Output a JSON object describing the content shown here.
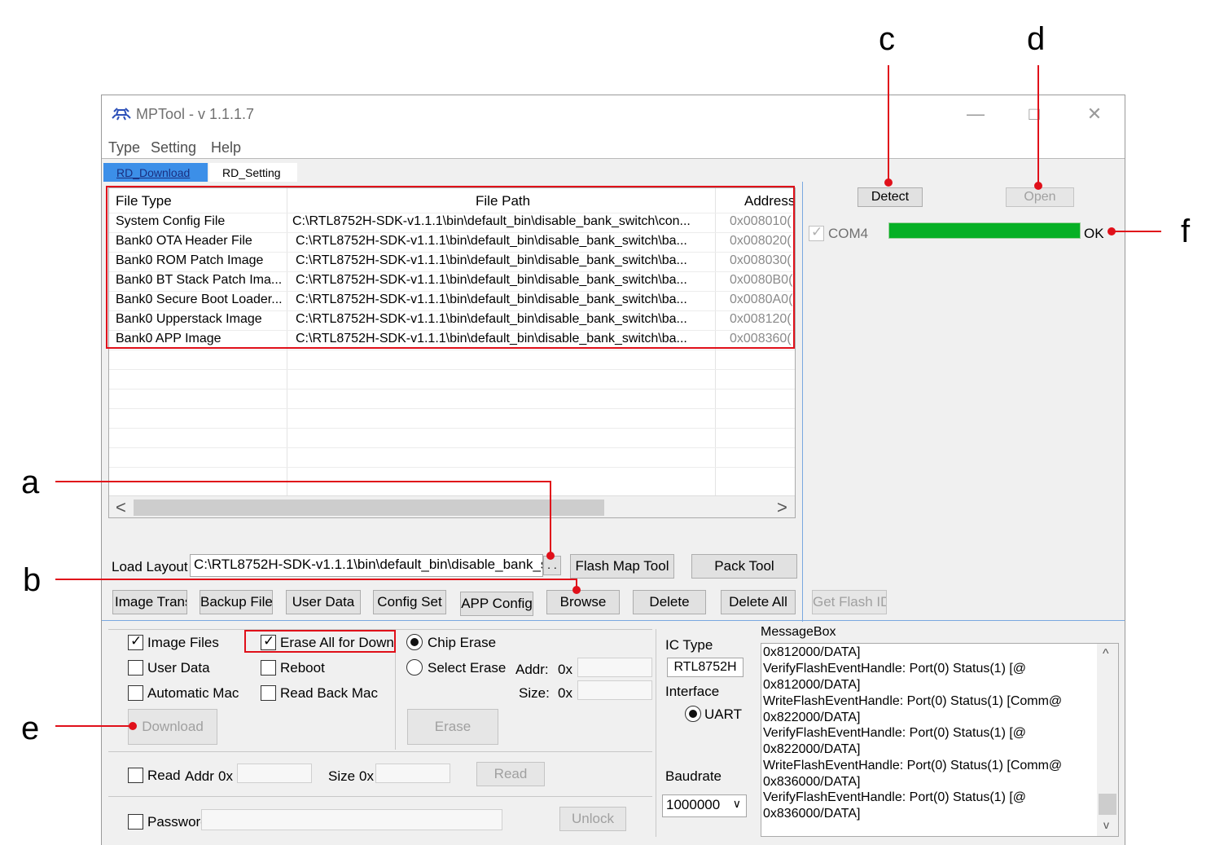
{
  "window": {
    "title": "MPTool - v 1.1.1.7",
    "controls": {
      "minimize": "—",
      "maximize": "□",
      "close": "✕"
    }
  },
  "menu": [
    "Type",
    "Setting",
    "Help"
  ],
  "tabs": [
    {
      "label": "RD_Download",
      "active": true
    },
    {
      "label": "RD_Setting",
      "active": false
    }
  ],
  "file_table": {
    "columns": [
      "File Type",
      "File Path",
      "Address"
    ],
    "rows": [
      {
        "type": "System Config File",
        "path": "C:\\RTL8752H-SDK-v1.1.1\\bin\\default_bin\\disable_bank_switch\\con...",
        "address": "0x008010("
      },
      {
        "type": "Bank0 OTA Header File",
        "path": "C:\\RTL8752H-SDK-v1.1.1\\bin\\default_bin\\disable_bank_switch\\ba...",
        "address": "0x008020("
      },
      {
        "type": "Bank0 ROM Patch Image",
        "path": "C:\\RTL8752H-SDK-v1.1.1\\bin\\default_bin\\disable_bank_switch\\ba...",
        "address": "0x008030("
      },
      {
        "type": "Bank0 BT Stack Patch Ima...",
        "path": "C:\\RTL8752H-SDK-v1.1.1\\bin\\default_bin\\disable_bank_switch\\ba...",
        "address": "0x0080B0("
      },
      {
        "type": "Bank0 Secure Boot Loader...",
        "path": "C:\\RTL8752H-SDK-v1.1.1\\bin\\default_bin\\disable_bank_switch\\ba...",
        "address": "0x0080A0("
      },
      {
        "type": "Bank0 Upperstack Image",
        "path": "C:\\RTL8752H-SDK-v1.1.1\\bin\\default_bin\\disable_bank_switch\\ba...",
        "address": "0x008120("
      },
      {
        "type": "Bank0 APP Image",
        "path": "C:\\RTL8752H-SDK-v1.1.1\\bin\\default_bin\\disable_bank_switch\\ba...",
        "address": "0x008360("
      }
    ],
    "scroll_left": "<",
    "scroll_right": ">"
  },
  "load_layout": {
    "label": "Load Layout",
    "value": "C:\\RTL8752H-SDK-v1.1.1\\bin\\default_bin\\disable_bank_s",
    "browse_dots": ". ."
  },
  "buttons": {
    "flash_map_tool": "Flash Map Tool",
    "pack_tool": "Pack Tool",
    "image_trans": "Image Trans",
    "backup_files": "Backup Files",
    "user_data": "User Data",
    "config_set": "Config Set",
    "app_config": "APP Config",
    "browse": "Browse",
    "delete": "Delete",
    "delete_all": "Delete All",
    "get_flash_id": "Get Flash ID",
    "detect": "Detect",
    "open": "Open",
    "download": "Download",
    "erase": "Erase",
    "read": "Read",
    "unlock": "Unlock"
  },
  "device": {
    "port": "COM4",
    "checked": true,
    "progress_pct": 100,
    "status": "OK",
    "progress_color": "#06b025"
  },
  "options": {
    "image_files": {
      "label": "Image Files",
      "checked": true
    },
    "user_data": {
      "label": "User Data",
      "checked": false
    },
    "automatic_mac": {
      "label": "Automatic Mac",
      "checked": false
    },
    "erase_all_for_down": {
      "label": "Erase All for Down",
      "checked": true
    },
    "reboot": {
      "label": "Reboot",
      "checked": false
    },
    "read_back_mac": {
      "label": "Read Back Mac",
      "checked": false
    }
  },
  "erase": {
    "chip_erase": {
      "label": "Chip Erase",
      "selected": true
    },
    "select_erase": {
      "label": "Select Erase",
      "selected": false
    },
    "addr_label": "Addr:",
    "addr_prefix": "0x",
    "size_label": "Size:",
    "size_prefix": "0x"
  },
  "read_row": {
    "label": "Read",
    "addr_label": "Addr",
    "addr_prefix": "0x",
    "size_label": "Size",
    "size_prefix": "0x"
  },
  "password": {
    "label": "Password"
  },
  "ic": {
    "type_label": "IC Type",
    "type_value": "RTL8752H",
    "interface_label": "Interface",
    "interface_value": "UART",
    "baudrate_label": "Baudrate",
    "baudrate_value": "1000000"
  },
  "messagebox": {
    "label": "MessageBox",
    "lines": [
      "0x812000/DATA]",
      "VerifyFlashEventHandle: Port(0) Status(1) [@",
      "0x812000/DATA]",
      "WriteFlashEventHandle: Port(0) Status(1) [Comm@",
      "0x822000/DATA]",
      "VerifyFlashEventHandle: Port(0) Status(1) [@",
      "0x822000/DATA]",
      "WriteFlashEventHandle: Port(0) Status(1) [Comm@",
      "0x836000/DATA]",
      "VerifyFlashEventHandle: Port(0) Status(1) [@",
      "0x836000/DATA]"
    ],
    "scroll_up": "^",
    "scroll_down": "v"
  },
  "callouts": [
    "a",
    "b",
    "c",
    "d",
    "e",
    "f"
  ],
  "annotation_color": "#e0101a"
}
